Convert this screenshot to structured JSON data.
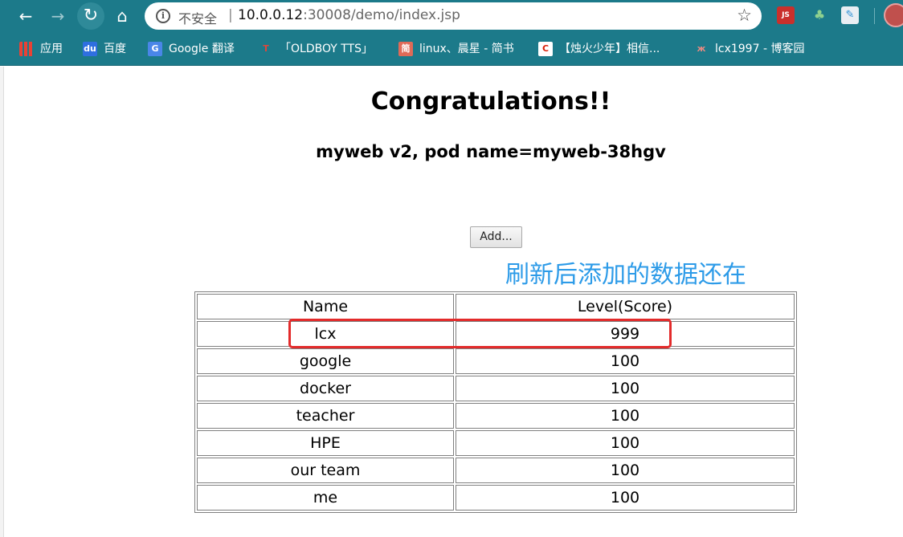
{
  "browser": {
    "security_label": "不安全",
    "url_host": "10.0.0.12",
    "url_rest": ":30008/demo/index.jsp",
    "extensions": [
      {
        "label": "JS",
        "icon": "js-extension-icon"
      },
      {
        "label": "♣",
        "icon": "leaf-extension-icon"
      },
      {
        "label": "✎",
        "icon": "note-extension-icon"
      }
    ]
  },
  "bookmarks": [
    {
      "label": "应用",
      "icon": "apps-grid-icon"
    },
    {
      "label": "百度",
      "icon": "baidu-paw-icon"
    },
    {
      "label": "Google 翻译",
      "icon": "google-translate-icon"
    },
    {
      "label": "「OLDBOY TTS」",
      "icon": "t-logo-icon"
    },
    {
      "label": "linux、晨星 - 简书",
      "icon": "jianshu-icon"
    },
    {
      "label": "【烛火少年】相信...",
      "icon": "csdn-c-icon"
    },
    {
      "label": "lcx1997 - 博客园",
      "icon": "cnblogs-icon"
    }
  ],
  "page": {
    "title": "Congratulations!!",
    "subtitle": "myweb v2, pod name=myweb-38hgv",
    "add_button": "Add...",
    "annotation": "刷新后添加的数据还在",
    "table": {
      "headers": [
        "Name",
        "Level(Score)"
      ],
      "rows": [
        [
          "lcx",
          "999"
        ],
        [
          "google",
          "100"
        ],
        [
          "docker",
          "100"
        ],
        [
          "teacher",
          "100"
        ],
        [
          "HPE",
          "100"
        ],
        [
          "our team",
          "100"
        ],
        [
          "me",
          "100"
        ]
      ]
    }
  },
  "colors": {
    "toolbar": "#1c7a8a",
    "annotation": "#2d9be8",
    "highlight_box": "#e32b2b"
  }
}
